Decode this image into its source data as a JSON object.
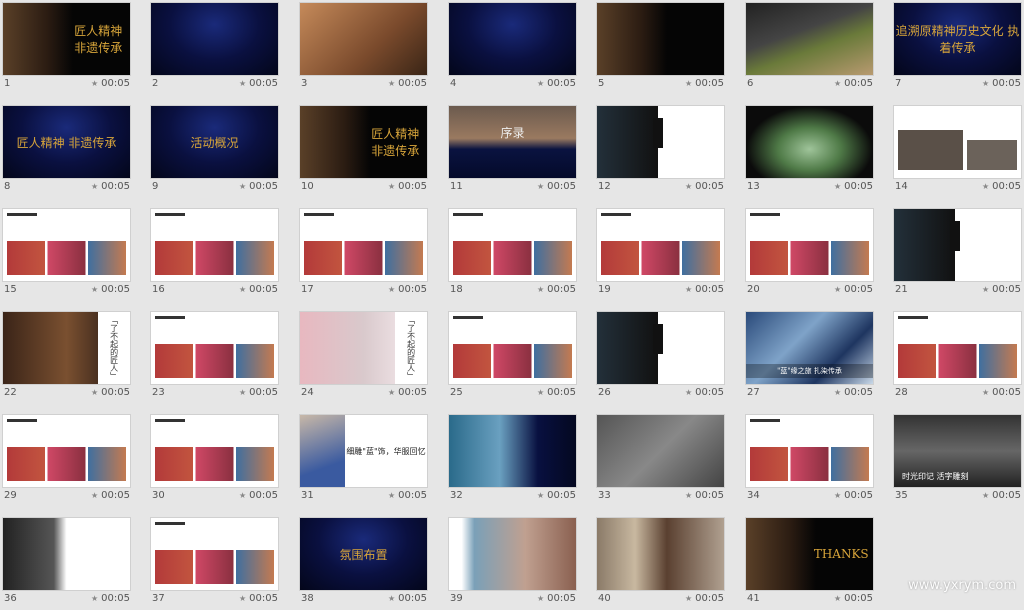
{
  "view": "slide-sorter",
  "watermark": "www.yxrym.com",
  "slides": [
    {
      "number": "1",
      "duration": "00:05",
      "theme": "dark",
      "title": "匠人精神 非遗传承"
    },
    {
      "number": "2",
      "duration": "00:05",
      "theme": "navy",
      "title": ""
    },
    {
      "number": "3",
      "duration": "00:05",
      "theme": "warm",
      "title": ""
    },
    {
      "number": "4",
      "duration": "00:05",
      "theme": "navy",
      "title": ""
    },
    {
      "number": "5",
      "duration": "00:05",
      "theme": "dark",
      "title": ""
    },
    {
      "number": "6",
      "duration": "00:05",
      "theme": "food",
      "title": ""
    },
    {
      "number": "7",
      "duration": "00:05",
      "theme": "navy",
      "title": "追溯原精神历史文化 执着传承"
    },
    {
      "number": "8",
      "duration": "00:05",
      "theme": "navy",
      "title": "匠人精神  非遗传承"
    },
    {
      "number": "9",
      "duration": "00:05",
      "theme": "navy",
      "title": "活动概况"
    },
    {
      "number": "10",
      "duration": "00:05",
      "theme": "dark",
      "title": "匠人精神 非遗传承"
    },
    {
      "number": "11",
      "duration": "00:05",
      "theme": "pnavy",
      "title": "序录"
    },
    {
      "number": "12",
      "duration": "00:05",
      "theme": "split",
      "title": ""
    },
    {
      "number": "13",
      "duration": "00:05",
      "theme": "stage",
      "title": ""
    },
    {
      "number": "14",
      "duration": "00:05",
      "theme": "wstage",
      "title": ""
    },
    {
      "number": "15",
      "duration": "00:05",
      "theme": "white",
      "title": ""
    },
    {
      "number": "16",
      "duration": "00:05",
      "theme": "white",
      "title": ""
    },
    {
      "number": "17",
      "duration": "00:05",
      "theme": "white",
      "title": ""
    },
    {
      "number": "18",
      "duration": "00:05",
      "theme": "white",
      "title": ""
    },
    {
      "number": "19",
      "duration": "00:05",
      "theme": "white",
      "title": ""
    },
    {
      "number": "20",
      "duration": "00:05",
      "theme": "white",
      "title": ""
    },
    {
      "number": "21",
      "duration": "00:05",
      "theme": "split",
      "title": ""
    },
    {
      "number": "22",
      "duration": "00:05",
      "theme": "wpr",
      "title": "「了不起的匠人」"
    },
    {
      "number": "23",
      "duration": "00:05",
      "theme": "white",
      "title": ""
    },
    {
      "number": "24",
      "duration": "00:05",
      "theme": "pink",
      "title": "「了不起的匠人」"
    },
    {
      "number": "25",
      "duration": "00:05",
      "theme": "white",
      "title": ""
    },
    {
      "number": "26",
      "duration": "00:05",
      "theme": "split",
      "title": ""
    },
    {
      "number": "27",
      "duration": "00:05",
      "theme": "blue",
      "title": "\"蓝\"缘之旅 扎染传承"
    },
    {
      "number": "28",
      "duration": "00:05",
      "theme": "white",
      "title": ""
    },
    {
      "number": "29",
      "duration": "00:05",
      "theme": "white",
      "title": ""
    },
    {
      "number": "30",
      "duration": "00:05",
      "theme": "white",
      "title": ""
    },
    {
      "number": "31",
      "duration": "00:05",
      "theme": "wphoto2",
      "title": "细雕\"蓝\"饰，华服回忆"
    },
    {
      "number": "32",
      "duration": "00:05",
      "theme": "bdark",
      "title": ""
    },
    {
      "number": "33",
      "duration": "00:05",
      "theme": "grey",
      "title": ""
    },
    {
      "number": "34",
      "duration": "00:05",
      "theme": "white",
      "title": ""
    },
    {
      "number": "35",
      "duration": "00:05",
      "theme": "gdark",
      "title": "时光印记  活字雕刻"
    },
    {
      "number": "36",
      "duration": "00:05",
      "theme": "gw",
      "title": ""
    },
    {
      "number": "37",
      "duration": "00:05",
      "theme": "white",
      "title": ""
    },
    {
      "number": "38",
      "duration": "00:05",
      "theme": "navy",
      "title": "氛围布置"
    },
    {
      "number": "39",
      "duration": "00:05",
      "theme": "wphoto",
      "title": ""
    },
    {
      "number": "40",
      "duration": "00:05",
      "theme": "photo",
      "title": ""
    },
    {
      "number": "41",
      "duration": "00:05",
      "theme": "dark",
      "title": "THANKS"
    }
  ]
}
